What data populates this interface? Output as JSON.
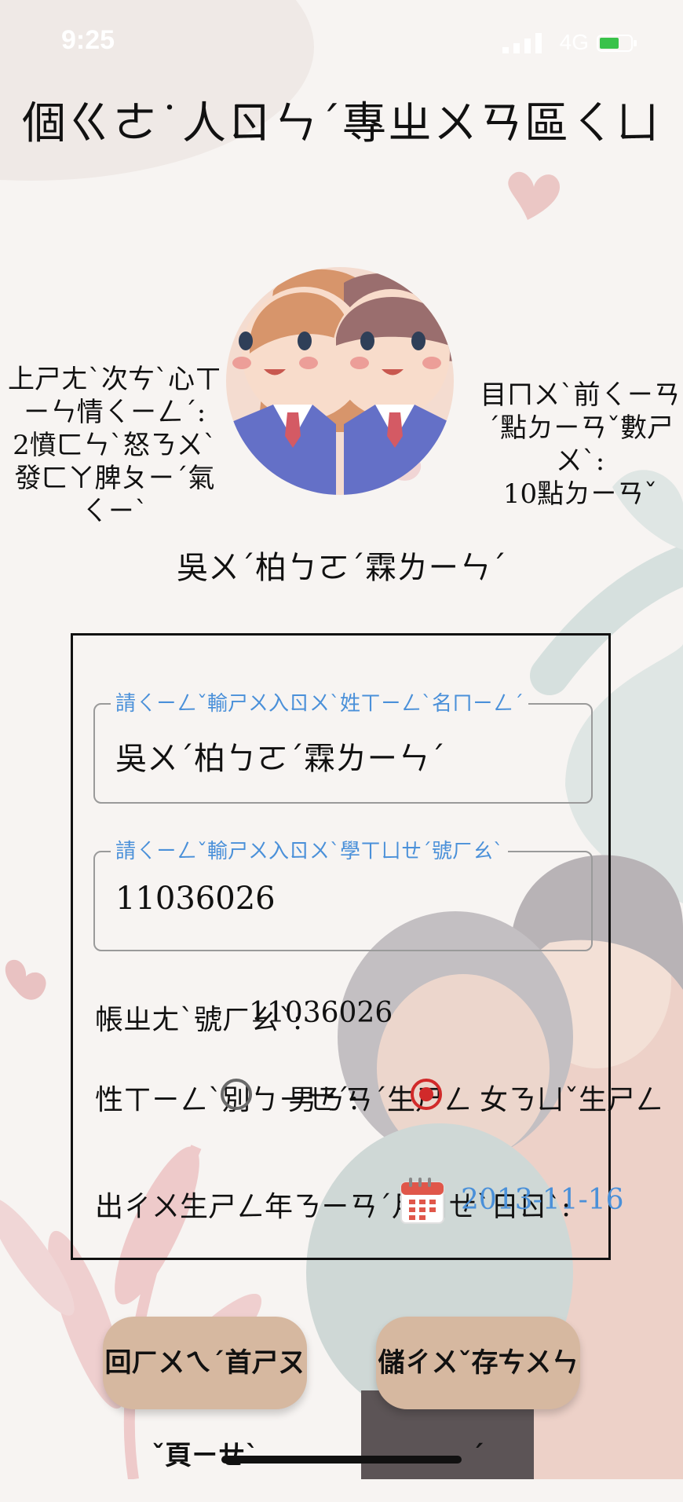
{
  "status_bar": {
    "time": "9:25",
    "network": "4G"
  },
  "header": {
    "title": "個ㄍㄜ˙人ㄖㄣˊ專ㄓㄨㄢ區ㄑㄩ"
  },
  "profile": {
    "last_mood_label": "上ㄕㄤˋ次ㄘˋ心ㄒㄧㄣ情ㄑㄧㄥˊ:",
    "last_mood_value": "2憤ㄈㄣˋ怒ㄋㄨˋ發ㄈㄚ脾ㄆㄧˊ氣ㄑㄧˋ",
    "points_label": "目ㄇㄨˋ前ㄑㄧㄢˊ點ㄉㄧㄢˇ數ㄕㄨˋ:",
    "points_value": "10點ㄉㄧㄢˇ",
    "username": "吳ㄨˊ柏ㄅㄛˊ霖ㄌㄧㄣˊ"
  },
  "form": {
    "name_field": {
      "legend": "請ㄑㄧㄥˇ輸ㄕㄨ入ㄖㄨˋ姓ㄒㄧㄥˋ名ㄇㄧㄥˊ",
      "value": "吳ㄨˊ柏ㄅㄛˊ霖ㄌㄧㄣˊ"
    },
    "student_id_field": {
      "legend": "請ㄑㄧㄥˇ輸ㄕㄨ入ㄖㄨˋ學ㄒㄩㄝˊ號ㄏㄠˋ",
      "value": "11036026"
    },
    "account": {
      "label": "帳ㄓㄤˋ號ㄏㄠˋ:",
      "value": "11036026"
    },
    "gender": {
      "label": "性ㄒㄧㄥˋ別ㄅㄧㄝˊ:",
      "male": "男ㄋㄢˊ生ㄕㄥ",
      "female": "女ㄋㄩˇ生ㄕㄥ",
      "selected": "female"
    },
    "birthday": {
      "label": "出ㄔㄨ生ㄕㄥ年ㄋㄧㄢˊ月ㄩㄝˋ日ㄖˋ:",
      "value": "2013-11-16"
    }
  },
  "buttons": {
    "home": "回ㄏㄨㄟˊ首ㄕㄡˇ頁ㄧㄝˋ",
    "save": "儲ㄔㄨˇ存ㄘㄨㄣˊ"
  },
  "colors": {
    "accent_blue": "#4a90d9",
    "radio_red": "#d12a2a",
    "button_tan": "#d6b8a0",
    "background": "#f7f4f2"
  }
}
